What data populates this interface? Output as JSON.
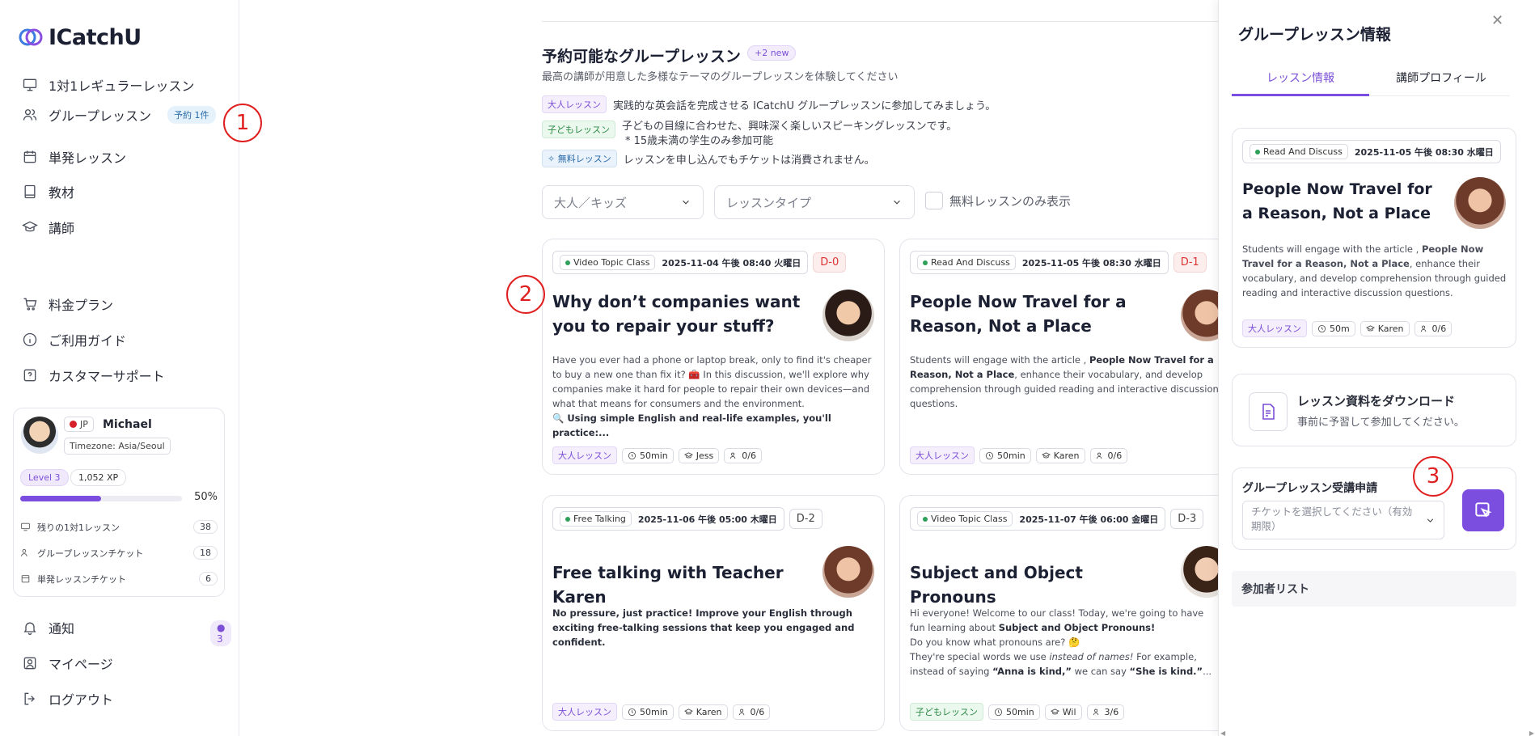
{
  "brand": {
    "name": "ICatchU",
    "accent": "#7c4ee0"
  },
  "sidebar": {
    "items": [
      {
        "label": "1対1レギュラーレッスン",
        "icon": "monitor-icon"
      },
      {
        "label": "グループレッスン",
        "icon": "users-icon",
        "badge": "予約 1件"
      },
      {
        "label": "単発レッスン",
        "icon": "calendar-icon"
      },
      {
        "label": "教材",
        "icon": "book-icon"
      },
      {
        "label": "講師",
        "icon": "graduation-cap-icon"
      },
      {
        "label": "料金プラン",
        "icon": "cart-icon"
      },
      {
        "label": "ご利用ガイド",
        "icon": "info-icon"
      },
      {
        "label": "カスタマーサポート",
        "icon": "help-icon"
      },
      {
        "label": "通知",
        "icon": "bell-icon",
        "badge": "● 3"
      },
      {
        "label": "マイページ",
        "icon": "user-square-icon"
      },
      {
        "label": "ログアウト",
        "icon": "logout-icon"
      }
    ],
    "user": {
      "country": "JP",
      "name": "Michael",
      "timezone": "Timezone: Asia/Seoul",
      "level": "Level 3",
      "xp": "1,052 XP",
      "progress_text": "50%",
      "progress_fraction": 0.5,
      "stats": [
        {
          "label": "残りの1対1レッスン",
          "count": "38"
        },
        {
          "label": "グループレッスンチケット",
          "count": "18"
        },
        {
          "label": "単発レッスンチケット",
          "count": "6"
        }
      ]
    }
  },
  "callouts": [
    "1",
    "2",
    "3"
  ],
  "main": {
    "title": "予約可能なグループレッスン",
    "new_badge": "+2 new",
    "subtitle": "最高の講師が用意した多様なテーマのグループレッスンを体験してください",
    "legend": [
      {
        "tag": "大人レッスン",
        "text": "実践的な英会話を完成させる ICatchU グループレッスンに参加してみましょう。"
      },
      {
        "tag": "子どもレッスン",
        "text": "子どもの目線に合わせた、興味深く楽しいスピーキングレッスンです。"
      },
      {
        "tag": "✧ 無料レッスン",
        "text": "レッスンを申し込んでもチケットは消費されません。"
      }
    ],
    "legend_note": "* 15歳未満の学生のみ参加可能",
    "filters": {
      "age": "大人／キッズ",
      "type": "レッスンタイプ",
      "free_only": "無料レッスンのみ表示"
    },
    "cards": [
      {
        "type": "Video Topic Class",
        "date": "2025-11-04 午後 08:40 火曜日",
        "dday": "D-0",
        "title": "Why don’t companies want you to repair your stuff?",
        "desc": "Have you ever had a phone or laptop break, only to find it's cheaper to buy a new one than fix it? 🧰 In this discussion, we'll explore why companies make it hard for people to repair their own devices—and what that means for consumers and the environment.",
        "desc_bold": "🔍 Using simple English and real-life examples, you'll practice:...",
        "tag": "大人レッスン",
        "duration": "50min",
        "teacher": "Jess",
        "seats": "0/6"
      },
      {
        "type": "Read And Discuss",
        "date": "2025-11-05 午後 08:30 水曜日",
        "dday": "D-1",
        "title": "People Now Travel for a Reason, Not a Place",
        "desc_pre": "Students will engage with the article , ",
        "desc_bold": "People Now Travel for a Reason, Not a Place",
        "desc_post": ", enhance  their vocabulary, and develop comprehension through guided reading and interactive discussion questions.",
        "tag": "大人レッスン",
        "duration": "50min",
        "teacher": "Karen",
        "seats": "0/6"
      },
      {
        "type": "Free Talking",
        "date": "2025-11-06 午後 05:00 木曜日",
        "dday": "D-2",
        "title": "Free talking with Teacher Karen",
        "desc_bold": "No pressure, just practice! Improve your English through exciting free-talking sessions that keep you engaged and confident.",
        "tag": "大人レッスン",
        "duration": "50min",
        "teacher": "Karen",
        "seats": "0/6"
      },
      {
        "type": "Video Topic Class",
        "date": "2025-11-07 午後 06:00 金曜日",
        "dday": "D-3",
        "title": "Subject and Object Pronouns",
        "desc_1": "Hi everyone! Welcome to our class! Today, we're going to have fun learning about ",
        "desc_1b": "Subject and Object Pronouns!",
        "desc_2": "Do you know what pronouns are? 🤔",
        "desc_3": "They're special words we use ",
        "desc_3i": "instead of names!",
        "desc_3b": " For example, instead of saying ",
        "desc_3c": "“Anna is kind,”",
        "desc_3d": " we can say ",
        "desc_3e": "“She is kind.”",
        "desc_3f": "...",
        "tag": "子どもレッスン",
        "duration": "50min",
        "teacher": "Wil",
        "seats": "3/6"
      }
    ]
  },
  "panel": {
    "title": "グループレッスン情報",
    "tabs": [
      "レッスン情報",
      "講師プロフィール"
    ],
    "lesson": {
      "type": "Read And Discuss",
      "date": "2025-11-05 午後 08:30 水曜日",
      "title": "People Now Travel for a Reason, Not a Place",
      "desc_pre": "Students will engage with the article , ",
      "desc_bold": "People Now Travel for a Reason, Not a Place",
      "desc_post": ", enhance  their vocabulary, and develop comprehension through guided reading and interactive discussion questions.",
      "tag": "大人レッスン",
      "duration": "50m",
      "teacher": "Karen",
      "seats": "0/6"
    },
    "download": {
      "title": "レッスン資料をダウンロード",
      "subtitle": "事前に予習して参加してください。"
    },
    "enroll": {
      "title": "グループレッスン受講申請",
      "placeholder": "チケットを選択してください（有効期限）"
    },
    "participants": "参加者リスト"
  }
}
